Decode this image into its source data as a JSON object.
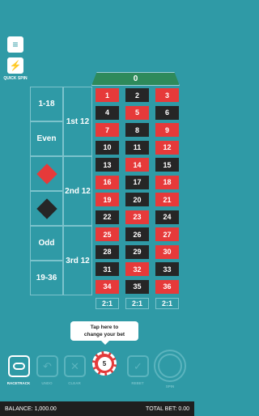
{
  "sidebar": {
    "quick_spin_label": "QUICK SPIN"
  },
  "board": {
    "zero": "0",
    "outside": {
      "low": "1-18",
      "even": "Even",
      "odd": "Odd",
      "high": "19-36",
      "first": "1st 12",
      "second": "2nd 12",
      "third": "3rd 12"
    },
    "rows": [
      [
        {
          "n": "1",
          "c": "red"
        },
        {
          "n": "2",
          "c": "black"
        },
        {
          "n": "3",
          "c": "red"
        }
      ],
      [
        {
          "n": "4",
          "c": "black"
        },
        {
          "n": "5",
          "c": "red"
        },
        {
          "n": "6",
          "c": "black"
        }
      ],
      [
        {
          "n": "7",
          "c": "red"
        },
        {
          "n": "8",
          "c": "black"
        },
        {
          "n": "9",
          "c": "red"
        }
      ],
      [
        {
          "n": "10",
          "c": "black"
        },
        {
          "n": "11",
          "c": "black"
        },
        {
          "n": "12",
          "c": "red"
        }
      ],
      [
        {
          "n": "13",
          "c": "black"
        },
        {
          "n": "14",
          "c": "red"
        },
        {
          "n": "15",
          "c": "black"
        }
      ],
      [
        {
          "n": "16",
          "c": "red"
        },
        {
          "n": "17",
          "c": "black"
        },
        {
          "n": "18",
          "c": "red"
        }
      ],
      [
        {
          "n": "19",
          "c": "red"
        },
        {
          "n": "20",
          "c": "black"
        },
        {
          "n": "21",
          "c": "red"
        }
      ],
      [
        {
          "n": "22",
          "c": "black"
        },
        {
          "n": "23",
          "c": "red"
        },
        {
          "n": "24",
          "c": "black"
        }
      ],
      [
        {
          "n": "25",
          "c": "red"
        },
        {
          "n": "26",
          "c": "black"
        },
        {
          "n": "27",
          "c": "red"
        }
      ],
      [
        {
          "n": "28",
          "c": "black"
        },
        {
          "n": "29",
          "c": "black"
        },
        {
          "n": "30",
          "c": "red"
        }
      ],
      [
        {
          "n": "31",
          "c": "black"
        },
        {
          "n": "32",
          "c": "red"
        },
        {
          "n": "33",
          "c": "black"
        }
      ],
      [
        {
          "n": "34",
          "c": "red"
        },
        {
          "n": "35",
          "c": "black"
        },
        {
          "n": "36",
          "c": "red"
        }
      ]
    ],
    "columns": [
      "2:1",
      "2:1",
      "2:1"
    ]
  },
  "tooltip": {
    "line1": "Tap here to",
    "line2": "change your bet"
  },
  "controls": {
    "racetrack": "RACETRACK",
    "undo": "UNDO",
    "clear": "CLEAR",
    "rebet": "REBET",
    "spin": "SPIN",
    "chip_value": "5"
  },
  "footer": {
    "balance": "BALANCE: 1,000.00",
    "total_bet": "TOTAL BET: 0.00"
  },
  "colors": {
    "red": "#e63a3a",
    "black": "#262626",
    "felt": "#2f9aa6",
    "zero": "#2e8a5b"
  }
}
